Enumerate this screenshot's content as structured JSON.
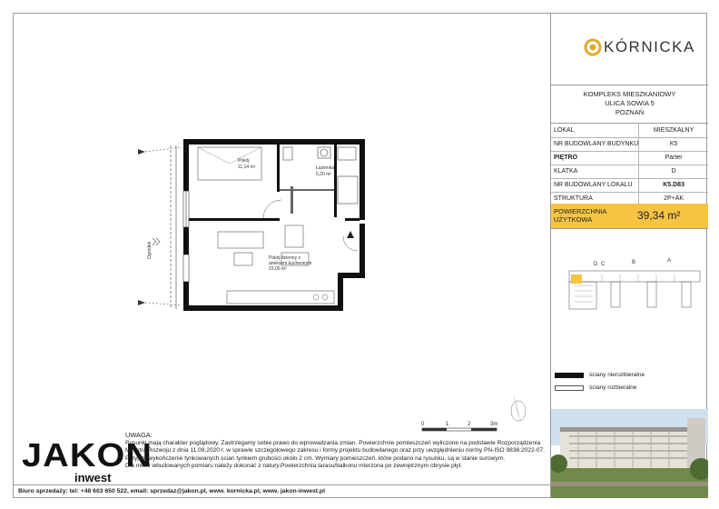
{
  "brand": {
    "name": "KÓRNICKA"
  },
  "complex": {
    "line1": "KOMPLEKS MIESZKANIOWY",
    "line2": "ULICA SOWIA 5",
    "line3": "POZNAŃ"
  },
  "info": [
    {
      "label": "LOKAL",
      "value": "MIESZKALNY"
    },
    {
      "label": "NR BUDOWLANY BUDYNKU",
      "value": "K5"
    },
    {
      "label": "PIĘTRO",
      "value": "Parter"
    },
    {
      "label": "KLATKA",
      "value": "D"
    },
    {
      "label": "NR BUDOWLANY LOKALU",
      "value": "K5.D83"
    },
    {
      "label": "STRUKTURA",
      "value": "2P+AK"
    }
  ],
  "area": {
    "label_line1": "POWIERZCHNIA",
    "label_line2": "UŻYTKOWA",
    "value": "39,34 m²"
  },
  "keyplan": {
    "labels": [
      "D",
      "C",
      "B",
      "A"
    ]
  },
  "legend": {
    "structural": "ściany nierozbieralne",
    "partition": "ściany rozbieralne"
  },
  "plan": {
    "room1_name": "Pokój",
    "room1_area": "11,14 m²",
    "room2_name": "Łazienka",
    "room2_area": "5,20 m²",
    "room3_line1": "Pokój dzienny z",
    "room3_line2": "aneksem kuchennym",
    "room3_area": "23,00 m²",
    "garden": "Ogródek"
  },
  "scale": {
    "labels": [
      "0",
      "1",
      "2",
      "3m"
    ]
  },
  "developer": {
    "name": "JAKON",
    "sub": "inwest"
  },
  "notes": {
    "title": "UWAGA:",
    "lines": [
      "Rysunki  mają  charakter  poglądowy. Zastrzegamy sobie prawo do wprowadzania zmian. Powierzchnie pomieszczeń wyliczone na podstawie Rozporządzenia",
      "Ministra Rozwoju z dnia 11.09.2020 r. w sprawie szczegółowego zakresu i formy projektu budowlanego oraz przy uwzględnieniu normy PN-ISO 9836:2022-07.",
      "Przyjęto wykończenie tynkowanych ścian tynkiem grubości około 2 cm. Wymiary pomieszczeń, które podano na rysunku, są w stanie surowym.",
      "Dla mebli wbudowanych pomiaru należy dokonać z natury.Powierzchnia tarasu/balkonu mierzona po zewnętrznym obrysie płyt."
    ]
  },
  "contact": {
    "label": "Biuro sprzedaży:",
    "text": "tel: +48 603 650 522, email: sprzedaz@jakon.pl, www. kornicka.pl, www. jakon-inwest.pl"
  }
}
